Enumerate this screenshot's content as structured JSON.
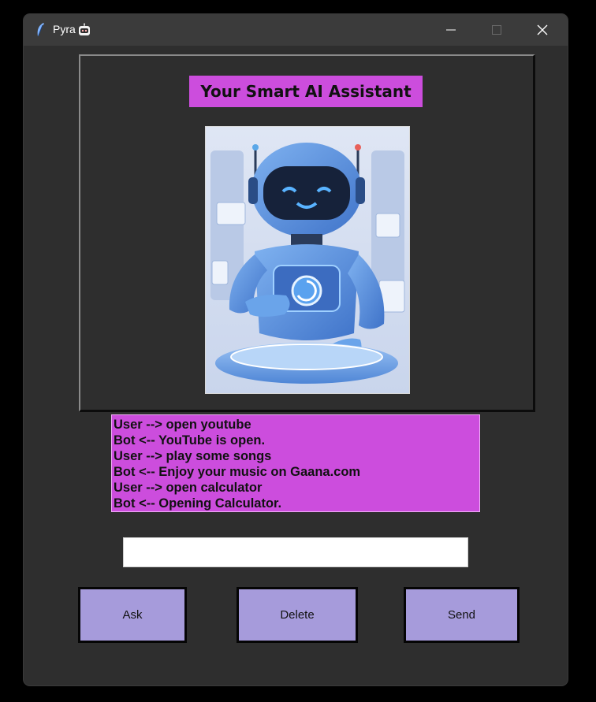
{
  "window": {
    "title": "Pyra",
    "title_icon": "robot-emoji-icon",
    "app_icon": "feather-icon",
    "controls": {
      "minimize": "minimize-icon",
      "maximize": "maximize-icon",
      "close": "close-icon"
    }
  },
  "header": {
    "title": "Your Smart AI Assistant"
  },
  "image": {
    "subject": "robot-illustration"
  },
  "chat": {
    "lines": [
      "User --> open youtube",
      "Bot <-- YouTube is open.",
      "User --> play some songs",
      "Bot <-- Enjoy your music on Gaana.com",
      "User --> open calculator",
      "Bot <-- Opening Calculator."
    ]
  },
  "input": {
    "value": "",
    "placeholder": ""
  },
  "buttons": {
    "ask": "Ask",
    "delete": "Delete",
    "send": "Send"
  },
  "colors": {
    "accent": "#cc4ddd",
    "button": "#a69bdb",
    "window_bg": "#2e2e2e",
    "titlebar_bg": "#3b3b3b"
  }
}
